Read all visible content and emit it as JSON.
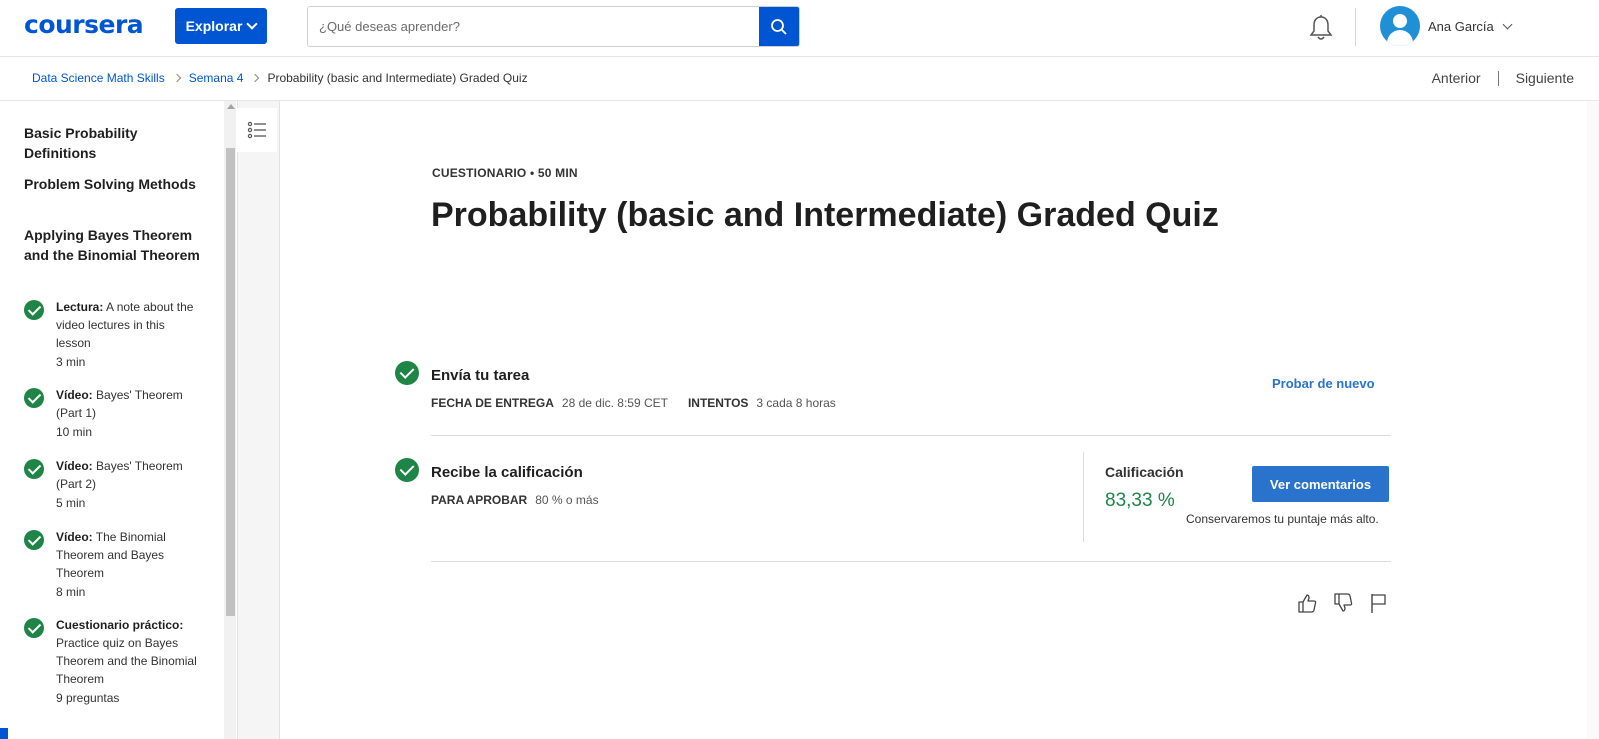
{
  "header": {
    "logo": "coursera",
    "explore_label": "Explorar",
    "search_placeholder": "¿Qué deseas aprender?",
    "user_name": "Ana García"
  },
  "breadcrumb": {
    "items": [
      "Data Science Math Skills",
      "Semana 4"
    ],
    "current": "Probability (basic and Intermediate) Graded Quiz",
    "prev_label": "Anterior",
    "next_label": "Siguiente"
  },
  "sidebar": {
    "sections": [
      "Basic Probability Definitions",
      "Problem Solving Methods",
      "Applying Bayes Theorem and the Binomial Theorem"
    ],
    "items": [
      {
        "type": "Lectura:",
        "title": "A note about the video lectures in this lesson",
        "duration": "3 min"
      },
      {
        "type": "Vídeo:",
        "title": "Bayes' Theorem (Part 1)",
        "duration": "10 min"
      },
      {
        "type": "Vídeo:",
        "title": "Bayes' Theorem (Part 2)",
        "duration": "5 min"
      },
      {
        "type": "Vídeo:",
        "title": "The Binomial Theorem and Bayes Theorem",
        "duration": "8 min"
      },
      {
        "type": "Cuestionario práctico:",
        "title": "Practice quiz on Bayes Theorem and the Binomial Theorem",
        "duration": "9 preguntas"
      }
    ]
  },
  "main": {
    "kicker": "CUESTIONARIO • 50 MIN",
    "title": "Probability (basic and Intermediate) Graded Quiz",
    "submit": {
      "title": "Envía tu tarea",
      "due_label": "FECHA DE ENTREGA",
      "due_value": "28 de dic. 8:59 CET",
      "attempts_label": "INTENTOS",
      "attempts_value": "3 cada 8 horas",
      "retry_label": "Probar de nuevo"
    },
    "grade": {
      "title": "Recibe la calificación",
      "pass_label": "PARA APROBAR",
      "pass_value": "80 % o más",
      "grade_label": "Calificación",
      "grade_value": "83,33 %",
      "note": "Conservaremos tu puntaje más alto.",
      "feedback_label": "Ver comentarios"
    }
  },
  "colors": {
    "brand": "#0056d2",
    "success": "#1e8546",
    "link": "#2a73cc"
  },
  "icons": [
    "search-icon",
    "bell-icon",
    "user-avatar-icon",
    "chevron-down-icon",
    "checkmark-icon",
    "list-icon",
    "thumbs-up-icon",
    "thumbs-down-icon",
    "flag-icon"
  ]
}
